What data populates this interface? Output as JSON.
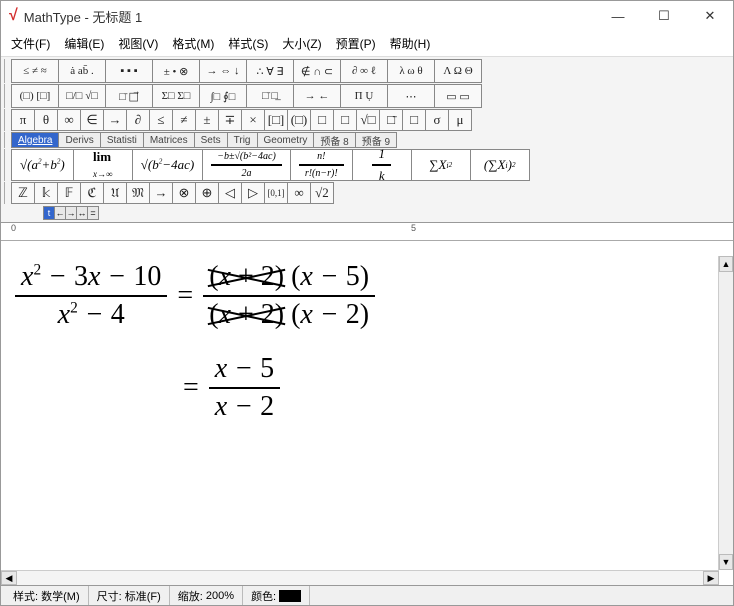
{
  "window": {
    "app": "MathType",
    "title": "MathType - 无标题 1"
  },
  "menu": {
    "items": [
      "文件(F)",
      "编辑(E)",
      "视图(V)",
      "格式(M)",
      "样式(S)",
      "大小(Z)",
      "预置(P)",
      "帮助(H)"
    ]
  },
  "toolbar_rows": {
    "row1": [
      "≤ ≠ ≈",
      "ȧ ab̄ .",
      "▪ ▪ ▪",
      "± • ⊗",
      "→ ⇔ ↓",
      "∴ ∀ ∃",
      "∉ ∩ ⊂",
      "∂ ∞ ℓ",
      "λ ω θ",
      "Λ Ω Θ"
    ],
    "row2": [
      "(□) [□]",
      "□/□ √□",
      "□̄ □⃗",
      "Σ□ Σ□",
      "∫□ ∮□",
      "□̄ □̲",
      "→ ←",
      "Π Ụ",
      "⋯",
      "▭ ▭"
    ],
    "row_small": [
      "π",
      "θ",
      "∞",
      "∈",
      "→",
      "∂",
      "≤",
      "≠",
      "±",
      "∓",
      "×",
      "[□]",
      "(□)",
      "□",
      "□",
      "√□",
      "□̄",
      "□",
      "σ",
      "μ"
    ],
    "tabs": [
      "Algebra",
      "Derivs",
      "Statisti",
      "Matrices",
      "Sets",
      "Trig",
      "Geometry",
      "预备 8",
      "预备 9"
    ],
    "big": [
      "√(a²+b²)",
      "lim x→∞",
      "√(b²−4ac)",
      "(−b±√(b²−4ac))/2a",
      "n! / r!(n−r)!",
      "1/k",
      "∑Xᵢ²",
      "(∑Xᵢ)²"
    ],
    "row_bottom": [
      "ℤ",
      "𝕜",
      "𝔽",
      "ℭ",
      "𝔘",
      "𝔐",
      "→",
      "⊗",
      "⊕",
      "◁",
      "▷",
      "[0,1]",
      "∞",
      "√2"
    ]
  },
  "ruler": {
    "marks": [
      "0",
      "5"
    ]
  },
  "equation": {
    "lhs_num": "x² − 3x − 10",
    "lhs_den": "x² − 4",
    "eq": "=",
    "rhs_num_a": "(x + 2)",
    "rhs_num_b": "(x − 5)",
    "rhs_den_a": "(x + 2)",
    "rhs_den_b": "(x − 2)",
    "line2_eq": "=",
    "line2_num": "x − 5",
    "line2_den": "x − 2"
  },
  "status": {
    "style_label": "样式:",
    "style_value": "数学(M)",
    "size_label": "尺寸:",
    "size_value": "标准(F)",
    "zoom_label": "缩放:",
    "zoom_value": "200%",
    "color_label": "颜色:"
  }
}
